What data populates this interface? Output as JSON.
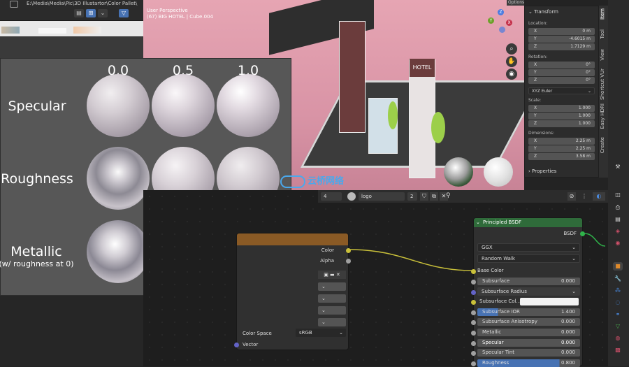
{
  "filebar": {
    "path": "E:\\Media\\Media\\Pic\\3D Illustartor\\Color Pallet\\",
    "view_buttons": [
      "▤",
      "⊞",
      "⌄"
    ],
    "filter_icon": "filter-icon"
  },
  "viewport": {
    "mode": "User Perspective",
    "object": "(67) BIG HOTEL | Cube.004",
    "sign_hotel": "HOTEL",
    "options_label": "Options"
  },
  "card": {
    "columns": [
      "0.0",
      "0.5",
      "1.0"
    ],
    "rows": [
      {
        "label": "Specular",
        "sub": ""
      },
      {
        "label": "Roughness",
        "sub": ""
      },
      {
        "label": "Metallic",
        "sub": "(w/ roughness at 0)"
      }
    ]
  },
  "npanel": {
    "transform_title": "Transform",
    "location_label": "Location:",
    "location": [
      {
        "axis": "X",
        "value": "0 m"
      },
      {
        "axis": "Y",
        "value": "-4.6015 m"
      },
      {
        "axis": "Z",
        "value": "1.7129 m"
      }
    ],
    "rotation_label": "Rotation:",
    "rotation": [
      {
        "axis": "X",
        "value": "0°"
      },
      {
        "axis": "Y",
        "value": "0°"
      },
      {
        "axis": "Z",
        "value": "0°"
      }
    ],
    "rotation_mode": "XYZ Euler",
    "scale_label": "Scale:",
    "scale": [
      {
        "axis": "X",
        "value": "1.000"
      },
      {
        "axis": "Y",
        "value": "1.000"
      },
      {
        "axis": "Z",
        "value": "1.000"
      }
    ],
    "dimensions_label": "Dimensions:",
    "dimensions": [
      {
        "axis": "X",
        "value": "2.25 m"
      },
      {
        "axis": "Y",
        "value": "2.25 m"
      },
      {
        "axis": "Z",
        "value": "3.58 m"
      }
    ],
    "properties_title": "Properties",
    "tabs": [
      "Item",
      "Tool",
      "View",
      "Shortcut VUr",
      "Easy HDRI",
      "Create"
    ]
  },
  "node_header": {
    "slot": "4",
    "material": "logo",
    "users": "2"
  },
  "image_node": {
    "outputs": [
      {
        "label": "Color"
      },
      {
        "label": "Alpha"
      }
    ],
    "color_space_label": "Color Space",
    "color_space_value": "sRGB",
    "vector_label": "Vector"
  },
  "bsdf": {
    "title": "Principled BSDF",
    "output": "BSDF",
    "distribution": "GGX",
    "subsurface_method": "Random Walk",
    "base_color": "Base Color",
    "rows": [
      {
        "label": "Subsurface",
        "value": "0.000"
      },
      {
        "label": "Subsurface Radius",
        "value": ""
      },
      {
        "label": "Subsurface Col...",
        "value": ""
      },
      {
        "label": "Subsurface IOR",
        "value": "1.400"
      },
      {
        "label": "Subsurface Anisotropy",
        "value": "0.000"
      },
      {
        "label": "Metallic",
        "value": "0.000"
      },
      {
        "label": "Specular",
        "value": "0.000"
      },
      {
        "label": "Specular Tint",
        "value": "0.000"
      },
      {
        "label": "Roughness",
        "value": "0.800"
      }
    ]
  },
  "watermark": "云桥网络",
  "colors": {
    "accent": "#4772b3",
    "bsdf_header": "#2f6b3a",
    "image_node_header": "#8a5a25",
    "wire": "#c9c03a",
    "shader_wire": "#2fb34a"
  }
}
